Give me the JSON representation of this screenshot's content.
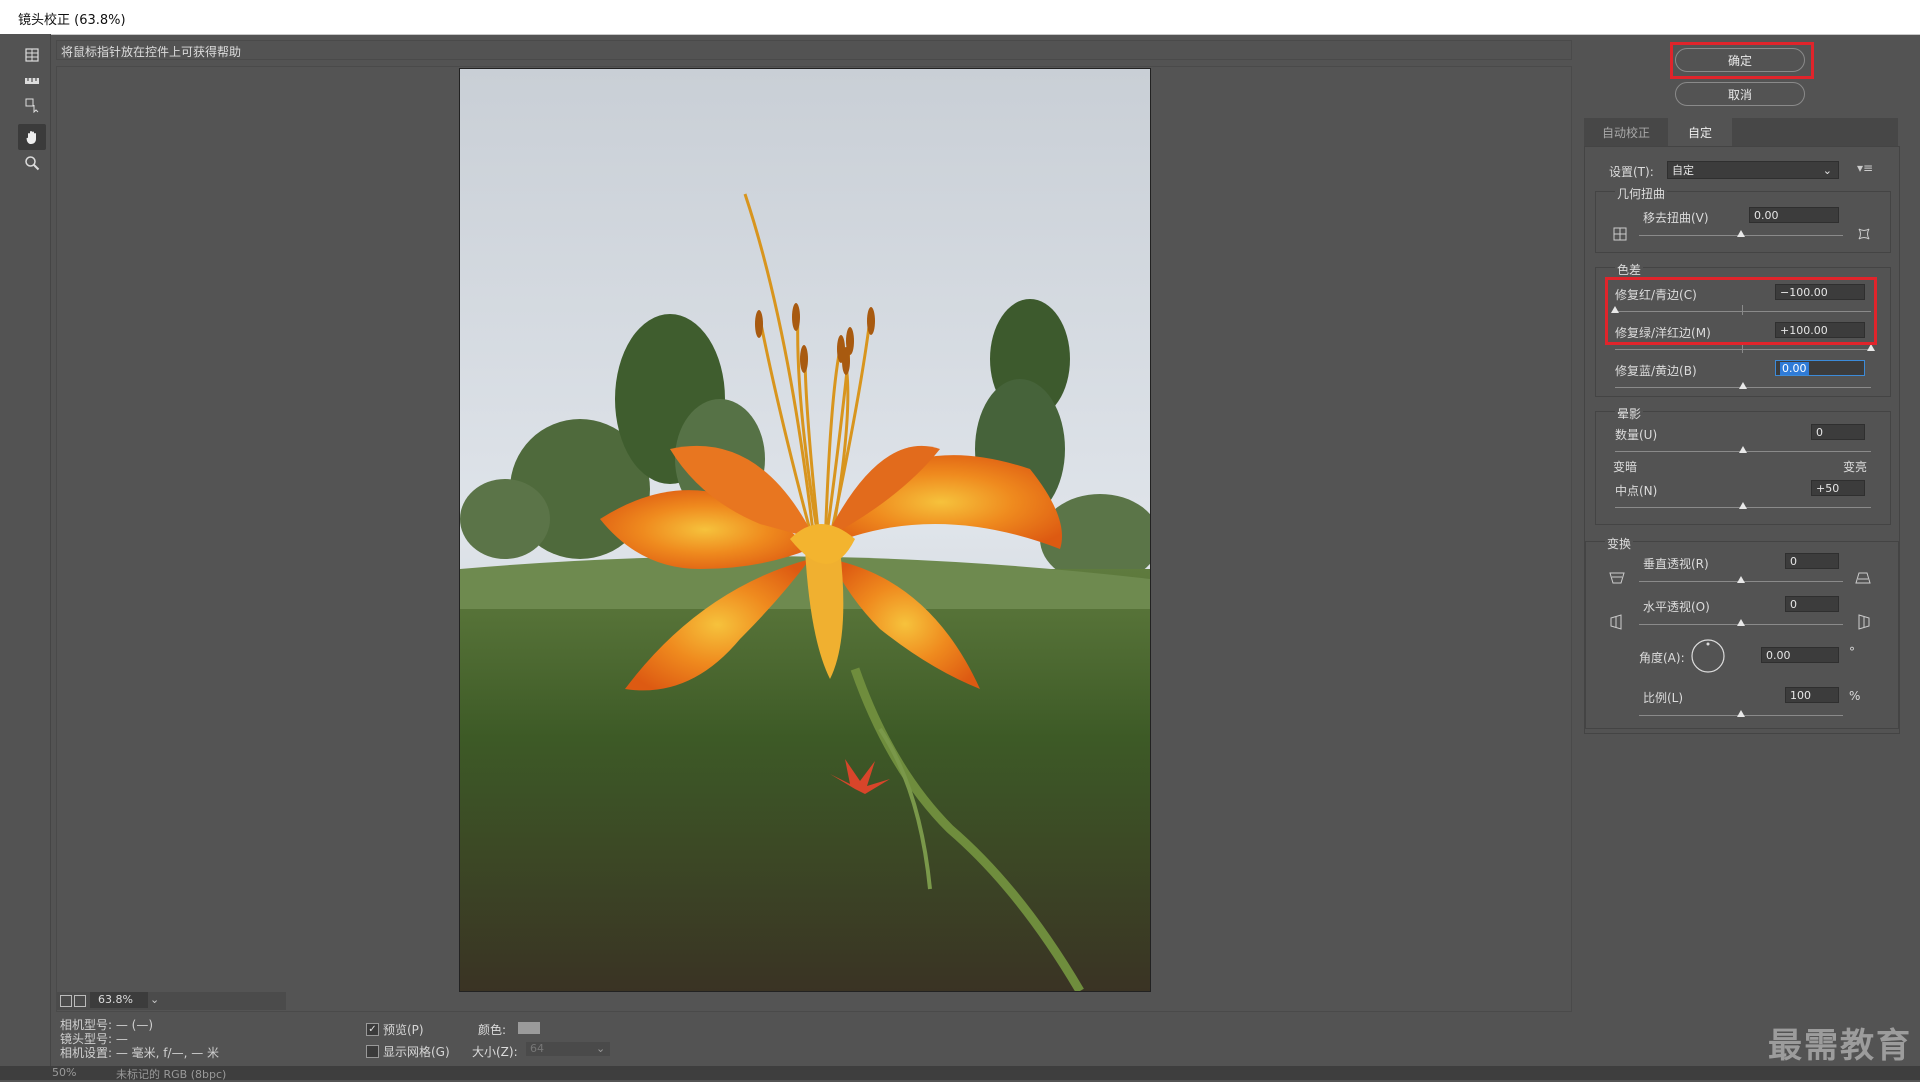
{
  "window": {
    "title": "镜头校正 (63.8%)"
  },
  "help_text": "将鼠标指针放在控件上可获得帮助",
  "toolbar": {
    "tools": [
      "remove-distortion-icon",
      "straighten-icon",
      "move-grid-icon",
      "hand-icon",
      "zoom-icon"
    ]
  },
  "buttons": {
    "ok": "确定",
    "cancel": "取消"
  },
  "tabs": {
    "auto": "自动校正",
    "custom": "自定"
  },
  "settings": {
    "label": "设置(T):",
    "value": "自定"
  },
  "geometric": {
    "title": "几何扭曲",
    "remove_distortion_label": "移去扭曲(V)",
    "remove_distortion_value": "0.00",
    "remove_distortion_level": 0.5
  },
  "chromatic": {
    "title": "色差",
    "red_cyan_label": "修复红/青边(C)",
    "red_cyan_value": "−100.00",
    "red_cyan_level": 0.0,
    "green_magenta_label": "修复绿/洋红边(M)",
    "green_magenta_value": "+100.00",
    "green_magenta_level": 1.0,
    "blue_yellow_label": "修复蓝/黄边(B)",
    "blue_yellow_value": "0.00",
    "blue_yellow_level": 0.5
  },
  "vignette": {
    "title": "晕影",
    "amount_label": "数量(U)",
    "amount_value": "0",
    "darken_label": "变暗",
    "lighten_label": "变亮",
    "midpoint_label": "中点(N)",
    "midpoint_value": "+50"
  },
  "transform": {
    "title": "变换",
    "vertical_label": "垂直透视(R)",
    "vertical_value": "0",
    "horizontal_label": "水平透视(O)",
    "horizontal_value": "0",
    "angle_label": "角度(A):",
    "angle_value": "0.00",
    "angle_unit": "°",
    "scale_label": "比例(L)",
    "scale_value": "100",
    "scale_unit": "%"
  },
  "zoom": {
    "value": "63.8%"
  },
  "camera_info": {
    "camera_model": "相机型号:  — (—)",
    "lens_model": "镜头型号:  —",
    "camera_settings": "相机设置:  — 毫米, f/—, — 米"
  },
  "preview": {
    "label": "预览(P)",
    "checked": true
  },
  "grid": {
    "show_label": "显示网格(G)",
    "color_label": "颜色:",
    "size_label": "大小(Z):",
    "size_value": "64"
  },
  "status": {
    "zoom": "50%",
    "doc": "未标记的 RGB (8bpc)"
  },
  "watermark": "最需教育",
  "colors": {
    "highlight_red": "#e0242b",
    "selection_blue": "#2f7bd7"
  }
}
